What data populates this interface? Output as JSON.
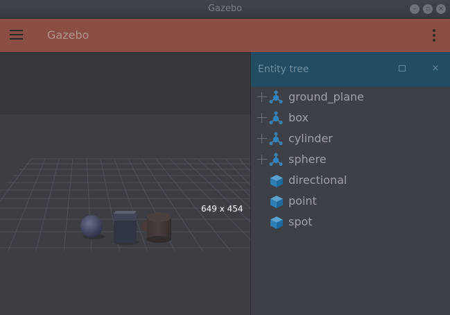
{
  "window": {
    "title": "Gazebo",
    "controls": [
      "minimize-icon",
      "maximize-icon",
      "close-icon"
    ]
  },
  "appbar": {
    "title": "Gazebo",
    "menu_icon": "hamburger-menu-icon",
    "overflow_icon": "kebab-menu-icon",
    "color": "#8a4e44"
  },
  "scene": {
    "size_label": "649 x 454",
    "objects": [
      "sphere",
      "box",
      "cylinder"
    ]
  },
  "entity_tree": {
    "title": "Entity tree",
    "header_color": "#224c62",
    "items": [
      {
        "label": "ground_plane",
        "type": "model",
        "expandable": true
      },
      {
        "label": "box",
        "type": "model",
        "expandable": true
      },
      {
        "label": "cylinder",
        "type": "model",
        "expandable": true
      },
      {
        "label": "sphere",
        "type": "model",
        "expandable": true
      },
      {
        "label": "directional",
        "type": "light",
        "expandable": false
      },
      {
        "label": "point",
        "type": "light",
        "expandable": false
      },
      {
        "label": "spot",
        "type": "light",
        "expandable": false
      }
    ]
  }
}
